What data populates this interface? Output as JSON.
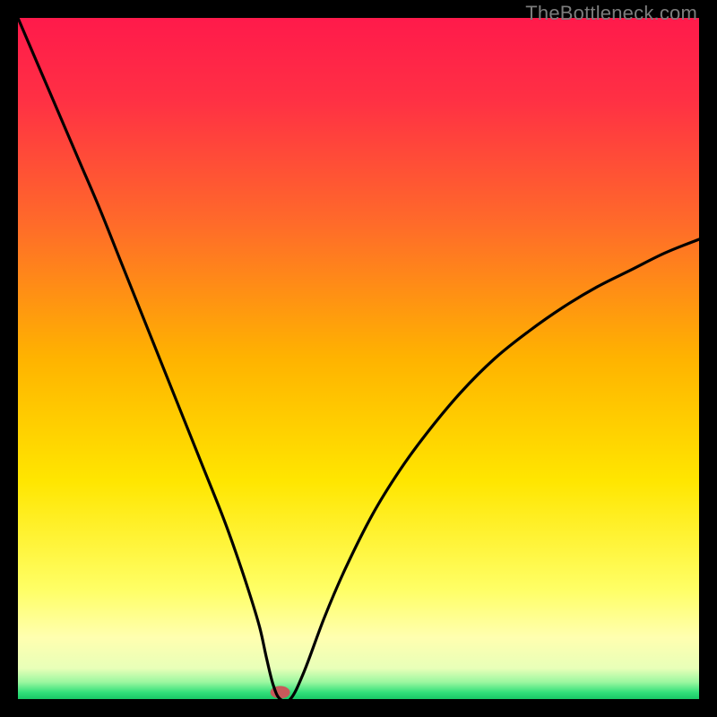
{
  "watermark": "TheBottleneck.com",
  "chart_data": {
    "type": "line",
    "title": "",
    "xlabel": "",
    "ylabel": "",
    "xlim": [
      0,
      100
    ],
    "ylim": [
      0,
      100
    ],
    "background_gradient": {
      "stops": [
        {
          "offset": 0.0,
          "color": "#ff1a4b"
        },
        {
          "offset": 0.12,
          "color": "#ff3044"
        },
        {
          "offset": 0.3,
          "color": "#ff6a2a"
        },
        {
          "offset": 0.5,
          "color": "#ffb300"
        },
        {
          "offset": 0.68,
          "color": "#ffe600"
        },
        {
          "offset": 0.84,
          "color": "#ffff66"
        },
        {
          "offset": 0.91,
          "color": "#ffffb0"
        },
        {
          "offset": 0.955,
          "color": "#e8ffb8"
        },
        {
          "offset": 0.975,
          "color": "#9cf7a0"
        },
        {
          "offset": 0.99,
          "color": "#33e07a"
        },
        {
          "offset": 1.0,
          "color": "#18c765"
        }
      ]
    },
    "series": [
      {
        "name": "bottleneck-curve",
        "x": [
          0.0,
          3.0,
          6.0,
          9.0,
          12.0,
          15.0,
          18.0,
          21.0,
          24.0,
          27.0,
          30.0,
          32.0,
          34.0,
          35.5,
          36.5,
          37.5,
          38.5,
          40.0,
          42.0,
          45.0,
          48.0,
          52.0,
          56.0,
          60.0,
          65.0,
          70.0,
          75.0,
          80.0,
          85.0,
          90.0,
          95.0,
          100.0
        ],
        "y": [
          100.0,
          93.0,
          86.0,
          79.0,
          72.0,
          64.5,
          57.0,
          49.5,
          42.0,
          34.5,
          27.0,
          21.5,
          15.5,
          10.5,
          6.0,
          2.0,
          0.0,
          0.0,
          4.0,
          12.0,
          19.0,
          27.0,
          33.5,
          39.0,
          45.0,
          50.0,
          54.0,
          57.5,
          60.5,
          63.0,
          65.5,
          67.5
        ]
      }
    ],
    "marker": {
      "name": "optimal-point",
      "x": 38.5,
      "y": 1.0,
      "color": "#c85a5a",
      "rx": 11,
      "ry": 7
    }
  }
}
